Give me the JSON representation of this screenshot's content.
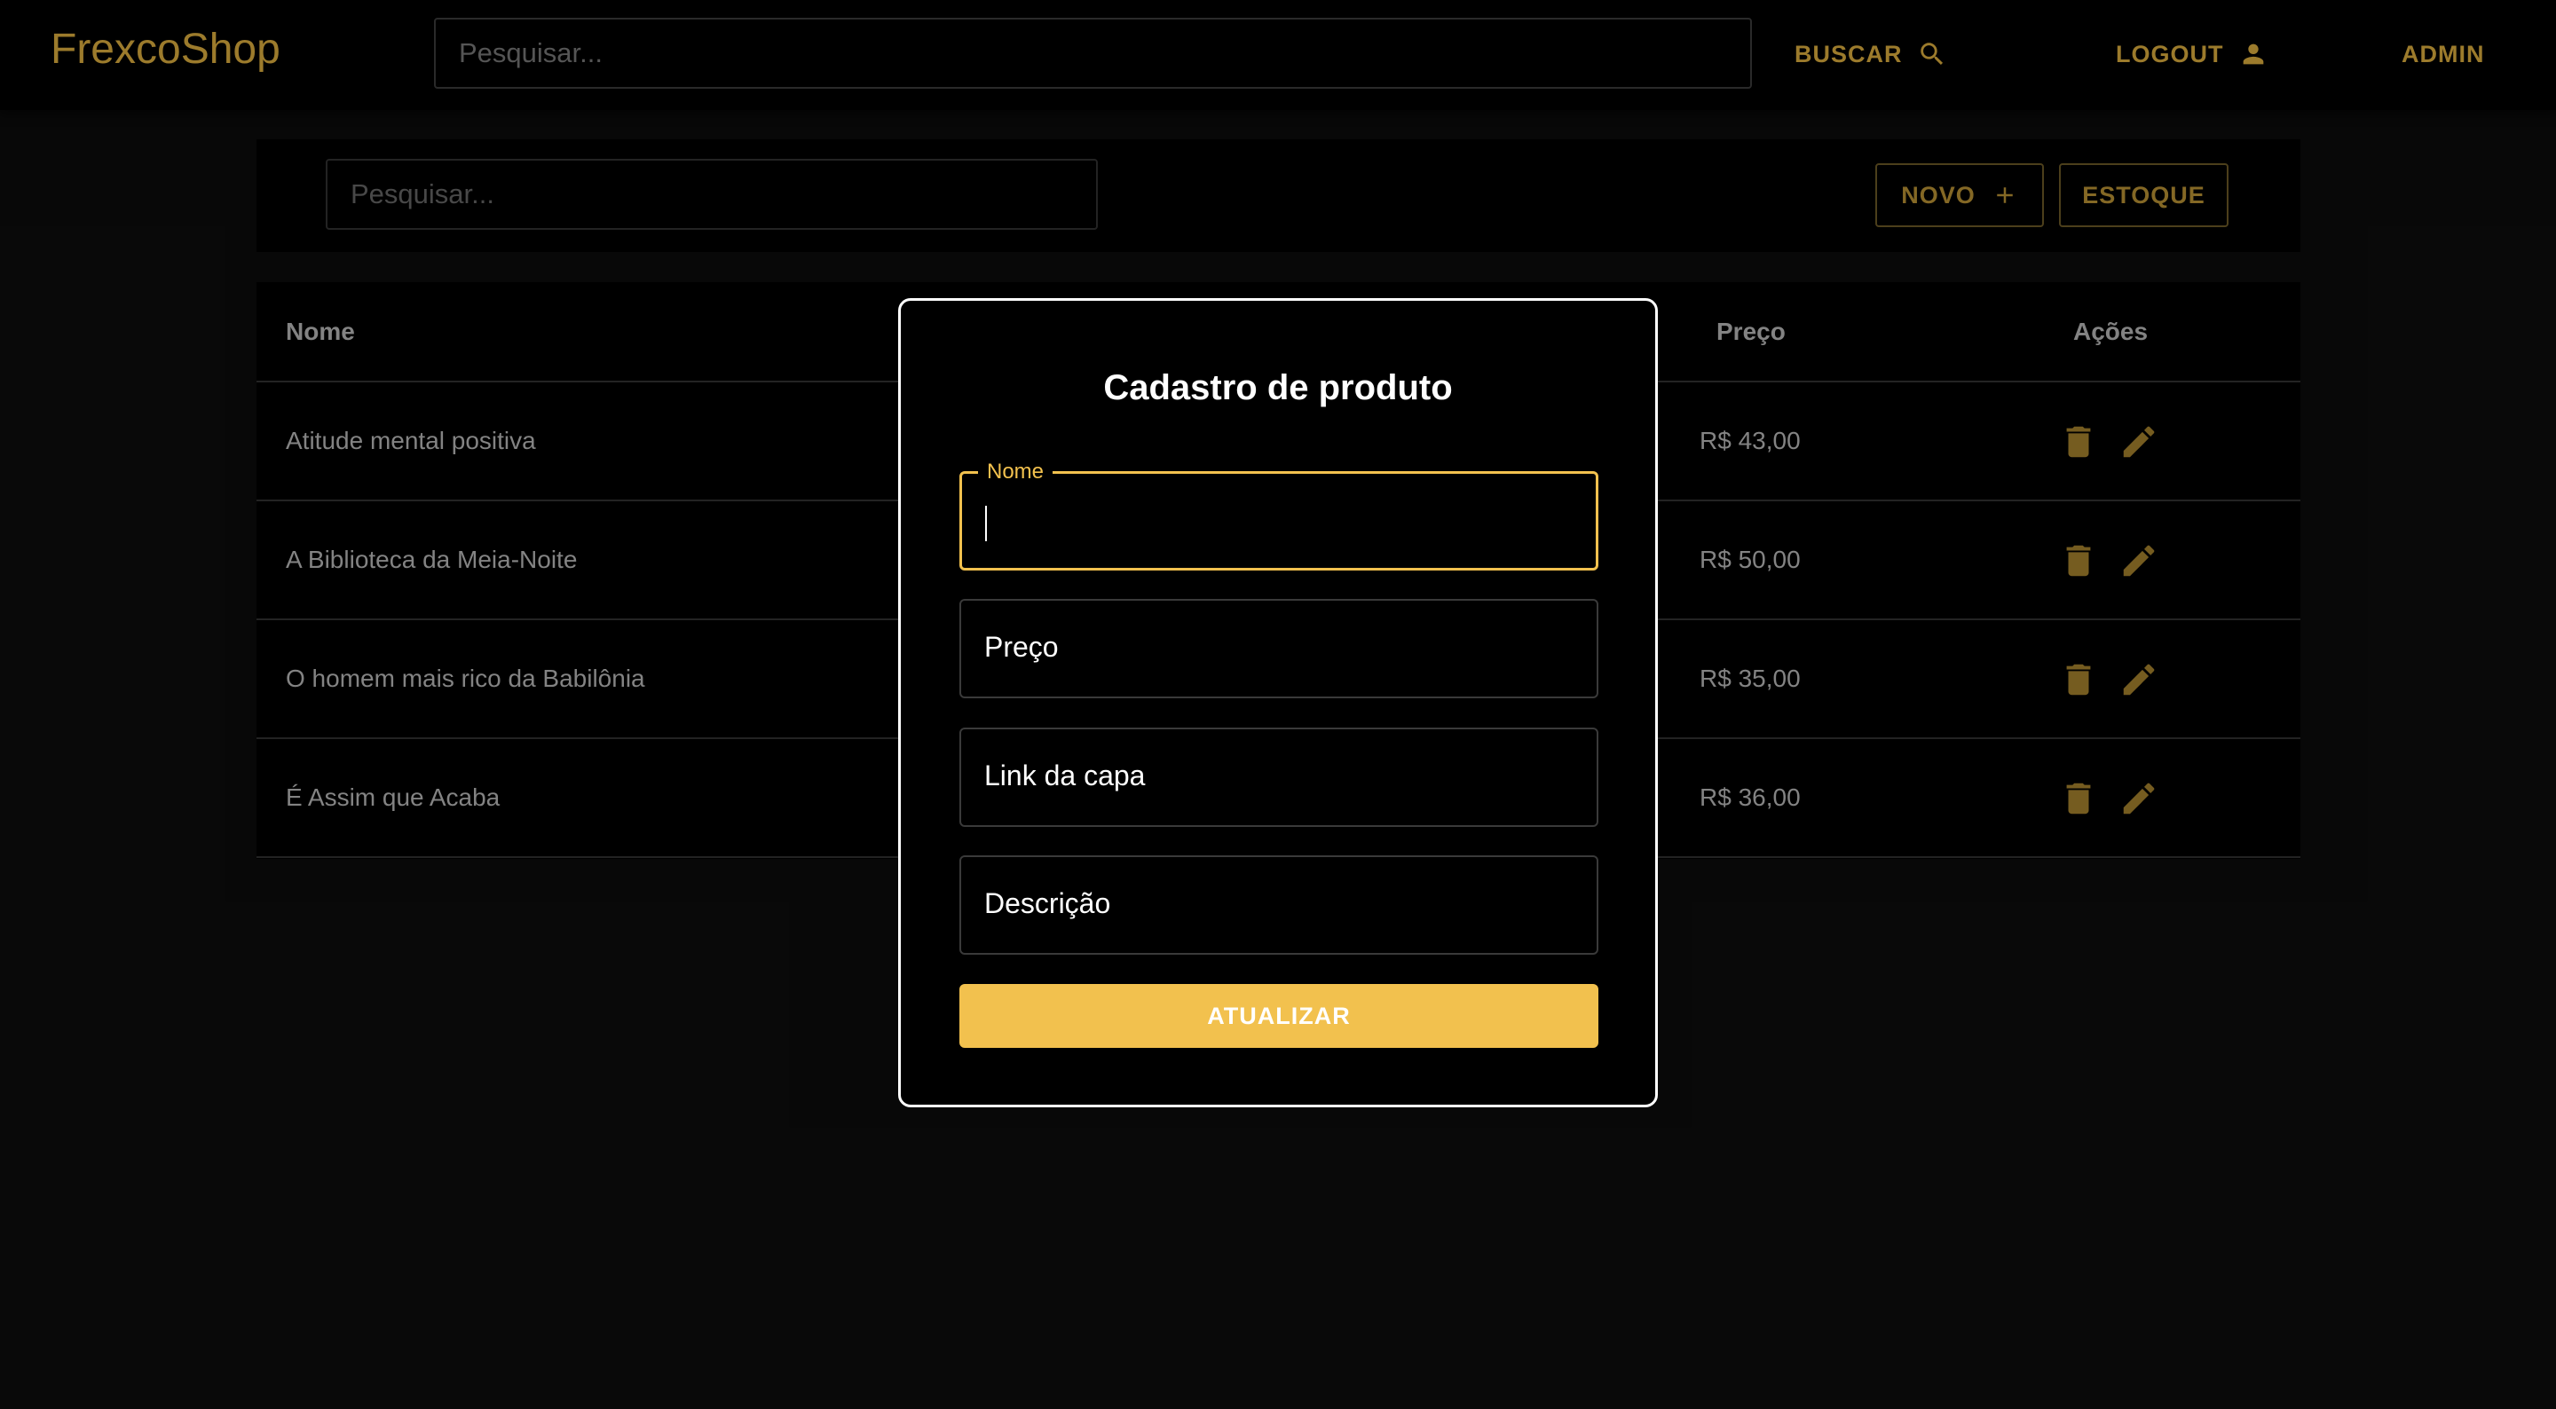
{
  "appbar": {
    "brand": "FrexcoShop",
    "search_placeholder": "Pesquisar...",
    "buscar_label": "BUSCAR",
    "logout_label": "LOGOUT",
    "admin_label": "ADMIN"
  },
  "toolbar": {
    "search_placeholder": "Pesquisar...",
    "novo_label": "NOVO",
    "estoque_label": "ESTOQUE"
  },
  "table": {
    "headers": {
      "name": "Nome",
      "price": "Preço",
      "actions": "Ações"
    },
    "rows": [
      {
        "name": "Atitude mental positiva",
        "price": "R$ 43,00"
      },
      {
        "name": "A Biblioteca da Meia-Noite",
        "price": "R$ 50,00"
      },
      {
        "name": "O homem mais rico da Babilônia",
        "price": "R$ 35,00"
      },
      {
        "name": "É Assim que Acaba",
        "price": "R$ 36,00"
      }
    ]
  },
  "modal": {
    "title": "Cadastro de produto",
    "fields": {
      "nome": {
        "label": "Nome",
        "value": ""
      },
      "preco": {
        "label": "Preço"
      },
      "link": {
        "label": "Link da capa"
      },
      "descricao": {
        "label": "Descrição"
      }
    },
    "submit_label": "ATUALIZAR"
  },
  "colors": {
    "accent": "#f2c14e",
    "muted_gold": "#9c7b2c",
    "background": "#0a0a0a"
  }
}
